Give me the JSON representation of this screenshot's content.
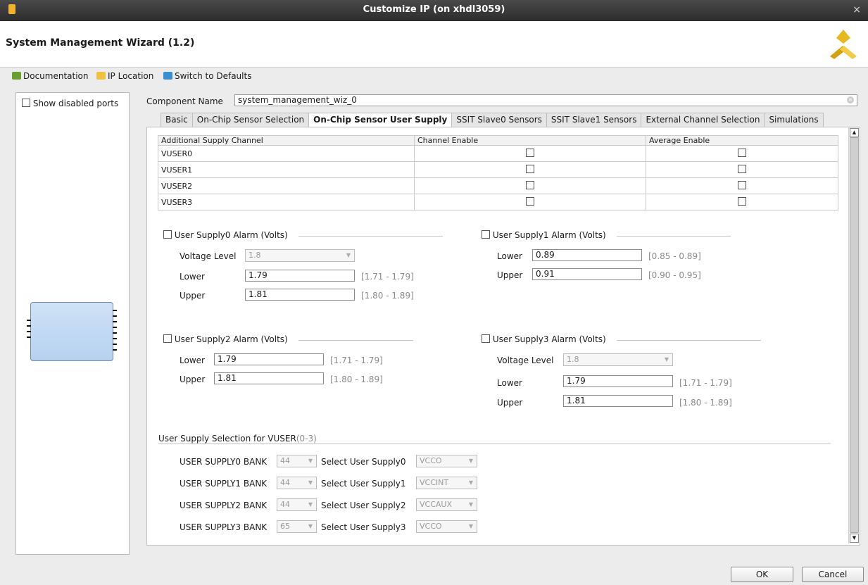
{
  "window": {
    "title": "Customize IP (on xhdl3059)",
    "close_glyph": "×"
  },
  "header": {
    "wizard_title": "System Management Wizard (1.2)",
    "logo": "xilinx-logo"
  },
  "toolbar": {
    "documentation": "Documentation",
    "ip_location": "IP Location",
    "switch_defaults": "Switch to Defaults"
  },
  "left": {
    "show_disabled_ports": "Show disabled ports"
  },
  "component": {
    "label": "Component Name",
    "value": "system_management_wiz_0"
  },
  "tabs": [
    {
      "label": "Basic",
      "active": false
    },
    {
      "label": "On-Chip Sensor Selection",
      "active": false
    },
    {
      "label": "On-Chip Sensor User Supply",
      "active": true
    },
    {
      "label": "SSIT Slave0 Sensors",
      "active": false
    },
    {
      "label": "SSIT Slave1 Sensors",
      "active": false
    },
    {
      "label": "External Channel Selection",
      "active": false
    },
    {
      "label": "Simulations",
      "active": false
    }
  ],
  "table": {
    "headers": [
      "Additional Supply Channel",
      "Channel Enable",
      "Average Enable"
    ],
    "rows": [
      {
        "name": "VUSER0",
        "channel_enable": false,
        "average_enable": false
      },
      {
        "name": "VUSER1",
        "channel_enable": false,
        "average_enable": false
      },
      {
        "name": "VUSER2",
        "channel_enable": false,
        "average_enable": false
      },
      {
        "name": "VUSER3",
        "channel_enable": false,
        "average_enable": false
      }
    ]
  },
  "supply0": {
    "title": "User Supply0 Alarm (Volts)",
    "checked": false,
    "voltage_level_label": "Voltage Level",
    "voltage_level": "1.8",
    "lower_label": "Lower",
    "lower": "1.79",
    "lower_range": "[1.71 - 1.79]",
    "upper_label": "Upper",
    "upper": "1.81",
    "upper_range": "[1.80 - 1.89]"
  },
  "supply1": {
    "title": "User Supply1 Alarm (Volts)",
    "checked": false,
    "lower_label": "Lower",
    "lower": "0.89",
    "lower_range": "[0.85 - 0.89]",
    "upper_label": "Upper",
    "upper": "0.91",
    "upper_range": "[0.90 - 0.95]"
  },
  "supply2": {
    "title": "User Supply2 Alarm (Volts)",
    "checked": false,
    "lower_label": "Lower",
    "lower": "1.79",
    "lower_range": "[1.71 - 1.79]",
    "upper_label": "Upper",
    "upper": "1.81",
    "upper_range": "[1.80 - 1.89]"
  },
  "supply3": {
    "title": "User Supply3 Alarm (Volts)",
    "checked": false,
    "voltage_level_label": "Voltage Level",
    "voltage_level": "1.8",
    "lower_label": "Lower",
    "lower": "1.79",
    "lower_range": "[1.71 - 1.79]",
    "upper_label": "Upper",
    "upper": "1.81",
    "upper_range": "[1.80 - 1.89]"
  },
  "selection": {
    "title": "User Supply Selection for VUSER",
    "title_suffix": "(0-3)",
    "rows": [
      {
        "bank_label": "USER SUPPLY0 BANK",
        "bank": "44",
        "select_label": "Select User Supply0",
        "supply": "VCCO"
      },
      {
        "bank_label": "USER SUPPLY1 BANK",
        "bank": "44",
        "select_label": "Select User Supply1",
        "supply": "VCCINT"
      },
      {
        "bank_label": "USER SUPPLY2 BANK",
        "bank": "44",
        "select_label": "Select User Supply2",
        "supply": "VCCAUX"
      },
      {
        "bank_label": "USER SUPPLY3 BANK",
        "bank": "65",
        "select_label": "Select User Supply3",
        "supply": "VCCO"
      }
    ]
  },
  "footer": {
    "ok": "OK",
    "cancel": "Cancel"
  },
  "colors": {
    "accent_tab": "#ffffff",
    "symbol_fill": "#cfe2f7",
    "logo_yellow": "#e8b820"
  }
}
